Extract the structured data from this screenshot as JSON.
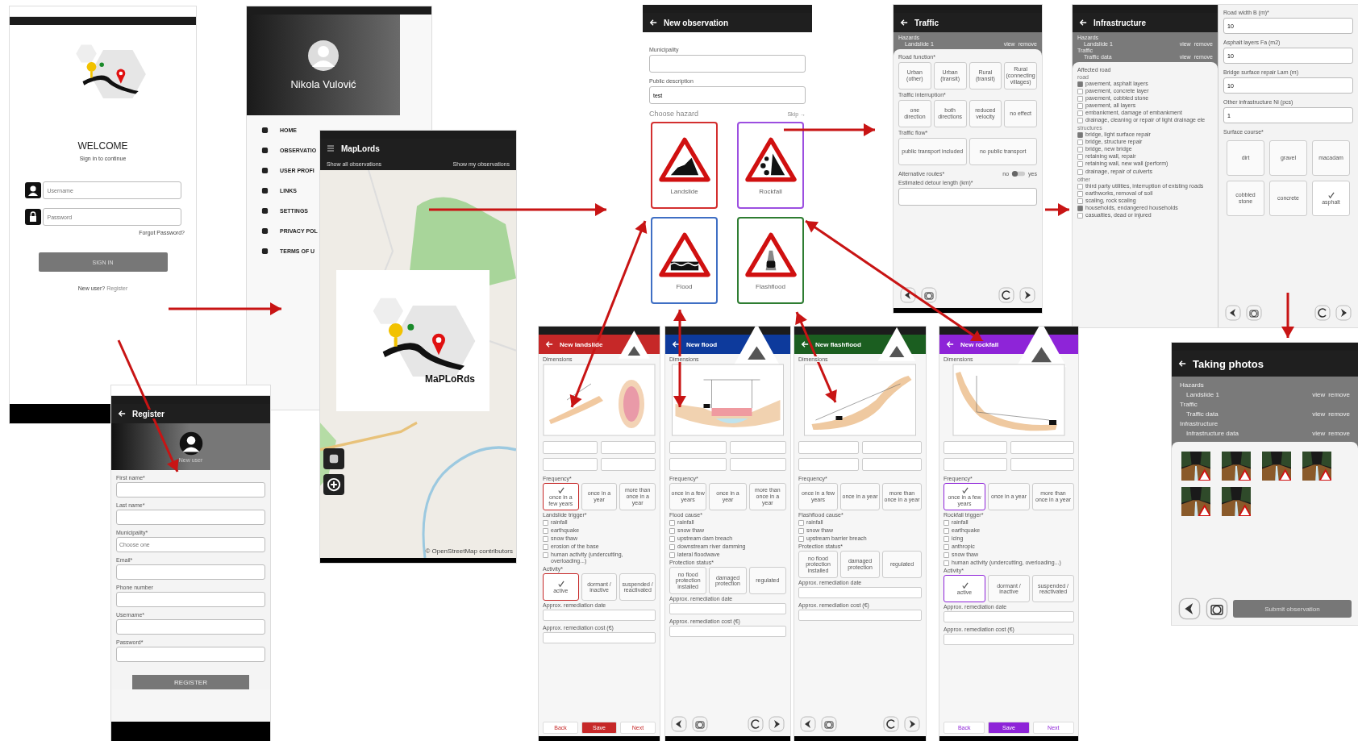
{
  "login": {
    "welcome": "WELCOME",
    "subtitle": "Sign in to continue",
    "username_placeholder": "Username",
    "password_placeholder": "Password",
    "forgot": "Forgot Password?",
    "button": "SIGN IN",
    "register_prompt": "New user?",
    "register_link": "Register"
  },
  "drawer": {
    "user_name": "Nikola Vulović",
    "items": [
      "HOME",
      "OBSERVATIO",
      "USER PROFI",
      "LINKS",
      "SETTINGS",
      "PRIVACY POL",
      "TERMS OF U"
    ]
  },
  "map": {
    "title": "MapLords",
    "tabs": [
      "Show all observations",
      "Show my observations"
    ],
    "logo": "MaPLoRds",
    "attribution": "© OpenStreetMap contributors"
  },
  "register": {
    "title": "Register",
    "subtitle": "New user",
    "fields": [
      {
        "label": "First name*"
      },
      {
        "label": "Last name*"
      },
      {
        "label": "Municipality*",
        "placeholder": "Choose one"
      },
      {
        "label": "Email*"
      },
      {
        "label": "Phone number"
      },
      {
        "label": "Username*"
      },
      {
        "label": "Password*"
      }
    ],
    "button": "REGISTER"
  },
  "new_observation": {
    "title": "New observation",
    "fields": [
      {
        "label": "Municipality"
      },
      {
        "label": "Public description",
        "value": "test"
      }
    ],
    "choose_hazard": "Choose hazard",
    "skip": "Skip →",
    "hazards": [
      {
        "label": "Landslide",
        "kind": "landslide",
        "color": "#d32f2f"
      },
      {
        "label": "Rockfall",
        "kind": "rockfall",
        "color": "#9c4fe0"
      },
      {
        "label": "Flood",
        "kind": "flood",
        "color": "#3f6fc4"
      },
      {
        "label": "Flashflood",
        "kind": "flashflood",
        "color": "#2e7d32"
      }
    ]
  },
  "traffic": {
    "title": "Traffic",
    "summary": [
      {
        "heading": "Hazards",
        "item": "Landslide 1",
        "actions": [
          "view",
          "remove"
        ]
      }
    ],
    "groups": [
      {
        "label": "Road function*",
        "options": [
          {
            "label": "Urban (other)",
            "selected": false
          },
          {
            "label": "Urban (transit)",
            "selected": false
          },
          {
            "label": "Rural (transit)",
            "selected": false
          },
          {
            "label": "Rural (connecting villages)",
            "selected": false
          }
        ]
      },
      {
        "label": "Traffic interruption*",
        "options": [
          {
            "label": "one direction",
            "selected": false
          },
          {
            "label": "both directions",
            "selected": false
          },
          {
            "label": "reduced velocity",
            "selected": false
          },
          {
            "label": "no effect",
            "selected": false
          }
        ]
      },
      {
        "label": "Traffic flow*",
        "options": [
          {
            "label": "public transport included",
            "selected": false
          },
          {
            "label": "no public transport",
            "selected": false
          }
        ]
      }
    ],
    "toggle": {
      "label": "Alternative routes*",
      "off_label": "no",
      "on_label": "yes",
      "on": false
    },
    "detour_label": "Estimated detour length (km)*"
  },
  "infrastructure": {
    "title": "Infrastructure",
    "summary": [
      {
        "heading": "Hazards",
        "item": "Landslide 1",
        "actions": [
          "view",
          "remove"
        ]
      },
      {
        "heading": "Traffic",
        "item": "Traffic data",
        "actions": [
          "view",
          "remove"
        ]
      }
    ],
    "checklist_title": "Affected road",
    "sections": [
      {
        "heading": "road",
        "items": [
          {
            "label": "pavement, asphalt layers",
            "checked": true
          },
          {
            "label": "pavement, concrete layer",
            "checked": false
          },
          {
            "label": "pavement, cobbled stone",
            "checked": false
          },
          {
            "label": "pavement, all layers",
            "checked": false
          },
          {
            "label": "embankment, damage of embankment",
            "checked": false
          },
          {
            "label": "drainage, cleaning or repair of light drainage ele",
            "checked": false
          }
        ]
      },
      {
        "heading": "structures",
        "items": [
          {
            "label": "bridge, light surface repair",
            "checked": true
          },
          {
            "label": "bridge, structure repair",
            "checked": false
          },
          {
            "label": "bridge, new bridge",
            "checked": false
          },
          {
            "label": "retaining wall, repair",
            "checked": false
          },
          {
            "label": "retaining wall, new wall (perform)",
            "checked": false
          },
          {
            "label": "drainage, repair of culverts",
            "checked": false
          }
        ]
      },
      {
        "heading": "other",
        "items": [
          {
            "label": "third party utilities, interruption of existing roads",
            "checked": false
          },
          {
            "label": "earthworks, removal of soil",
            "checked": false
          },
          {
            "label": "scaling, rock scaling",
            "checked": false
          },
          {
            "label": "households, endangered households",
            "checked": true
          },
          {
            "label": "casualties, dead or injured",
            "checked": false
          }
        ]
      }
    ],
    "fields": [
      {
        "label": "Road width B (m)*",
        "value": "10"
      },
      {
        "label": "Asphalt layers Fa (m2)",
        "value": "10"
      },
      {
        "label": "Bridge surface repair Lam (m)",
        "value": "10"
      },
      {
        "label": "Other infrastructure Ni (pcs)",
        "value": "1"
      }
    ],
    "surface_label": "Surface course*",
    "surface_options": [
      {
        "label": "dirt",
        "selected": false
      },
      {
        "label": "gravel",
        "selected": false
      },
      {
        "label": "macadam",
        "selected": false
      },
      {
        "label": "cobbled stone",
        "selected": false
      },
      {
        "label": "concrete",
        "selected": false
      },
      {
        "label": "asphalt",
        "selected": true
      }
    ]
  },
  "forms": [
    {
      "title": "New landslide",
      "kind": "landslide",
      "color": "#c62828",
      "section": "Dimensions",
      "frequency_label": "Frequency*",
      "frequency": [
        {
          "label": "once in a few years",
          "selected": true
        },
        {
          "label": "once in a year",
          "selected": false
        },
        {
          "label": "more than once in a year",
          "selected": false
        }
      ],
      "cause_label": "Landslide trigger*",
      "causes": [
        {
          "label": "rainfall",
          "checked": false
        },
        {
          "label": "earthquake",
          "checked": false
        },
        {
          "label": "snow thaw",
          "checked": false
        },
        {
          "label": "erosion of the base",
          "checked": false
        },
        {
          "label": "human activity (undercutting, overloading...)",
          "checked": false
        }
      ],
      "status_label": "Activity*",
      "status": [
        {
          "label": "active",
          "selected": true
        },
        {
          "label": "dormant / inactive",
          "selected": false
        },
        {
          "label": "suspended / reactivated",
          "selected": false
        }
      ],
      "date_label": "Approx. remediation date",
      "cost_label": "Approx. remediation cost (€)",
      "buttons": [
        "Back",
        "Save",
        "Next"
      ]
    },
    {
      "title": "New flood",
      "kind": "flood",
      "color": "#0d3a9c",
      "section": "Dimensions",
      "frequency_label": "Frequency*",
      "frequency": [
        {
          "label": "once in a few years",
          "selected": false
        },
        {
          "label": "once in a year",
          "selected": false
        },
        {
          "label": "more than once in a year",
          "selected": false
        }
      ],
      "cause_label": "Flood cause*",
      "causes": [
        {
          "label": "rainfall",
          "checked": false
        },
        {
          "label": "snow thaw",
          "checked": false
        },
        {
          "label": "upstream dam breach",
          "checked": false
        },
        {
          "label": "downstream river damming",
          "checked": false
        },
        {
          "label": "lateral floodwave",
          "checked": false
        }
      ],
      "status_label": "Protection status*",
      "status": [
        {
          "label": "no flood protection installed",
          "selected": false
        },
        {
          "label": "damaged protection",
          "selected": false
        },
        {
          "label": "regulated",
          "selected": false
        }
      ],
      "date_label": "Approx. remediation date",
      "cost_label": "Approx. remediation cost (€)"
    },
    {
      "title": "New flashflood",
      "kind": "flashflood",
      "color": "#1b5e20",
      "section": "Dimensions",
      "frequency_label": "Frequency*",
      "frequency": [
        {
          "label": "once in a few years",
          "selected": false
        },
        {
          "label": "once in a year",
          "selected": false
        },
        {
          "label": "more than once in a year",
          "selected": false
        }
      ],
      "cause_label": "Flashflood cause*",
      "causes": [
        {
          "label": "rainfall",
          "checked": false
        },
        {
          "label": "snow thaw",
          "checked": false
        },
        {
          "label": "upstream barrier breach",
          "checked": false
        }
      ],
      "status_label": "Protection status*",
      "status": [
        {
          "label": "no flood protection installed",
          "selected": false
        },
        {
          "label": "damaged protection",
          "selected": false
        },
        {
          "label": "regulated",
          "selected": false
        }
      ],
      "date_label": "Approx. remediation date",
      "cost_label": "Approx. remediation cost (€)"
    },
    {
      "title": "New rockfall",
      "kind": "rockfall",
      "color": "#8e24d8",
      "section": "Dimensions",
      "frequency_label": "Frequency*",
      "frequency": [
        {
          "label": "once in a few years",
          "selected": true
        },
        {
          "label": "once in a year",
          "selected": false
        },
        {
          "label": "more than once in a year",
          "selected": false
        }
      ],
      "cause_label": "Rockfall trigger*",
      "causes": [
        {
          "label": "rainfall",
          "checked": false
        },
        {
          "label": "earthquake",
          "checked": false
        },
        {
          "label": "icing",
          "checked": false
        },
        {
          "label": "anthropic",
          "checked": false
        },
        {
          "label": "snow thaw",
          "checked": false
        },
        {
          "label": "human activity (undercutting, overloading...)",
          "checked": false
        }
      ],
      "status_label": "Activity*",
      "status": [
        {
          "label": "active",
          "selected": true
        },
        {
          "label": "dormant / inactive",
          "selected": false
        },
        {
          "label": "suspended / reactivated",
          "selected": false
        }
      ],
      "date_label": "Approx. remediation date",
      "cost_label": "Approx. remediation cost (€)",
      "buttons": [
        "Back",
        "Save",
        "Next"
      ]
    }
  ],
  "photos": {
    "title": "Taking photos",
    "summary": [
      {
        "heading": "Hazards",
        "item": "Landslide 1",
        "actions": [
          "view",
          "remove"
        ]
      },
      {
        "heading": "Traffic",
        "item": "Traffic data",
        "actions": [
          "view",
          "remove"
        ]
      },
      {
        "heading": "Infrastructure",
        "item": "Infrastructure data",
        "actions": [
          "view",
          "remove"
        ]
      }
    ],
    "submit": "Submit observation"
  }
}
